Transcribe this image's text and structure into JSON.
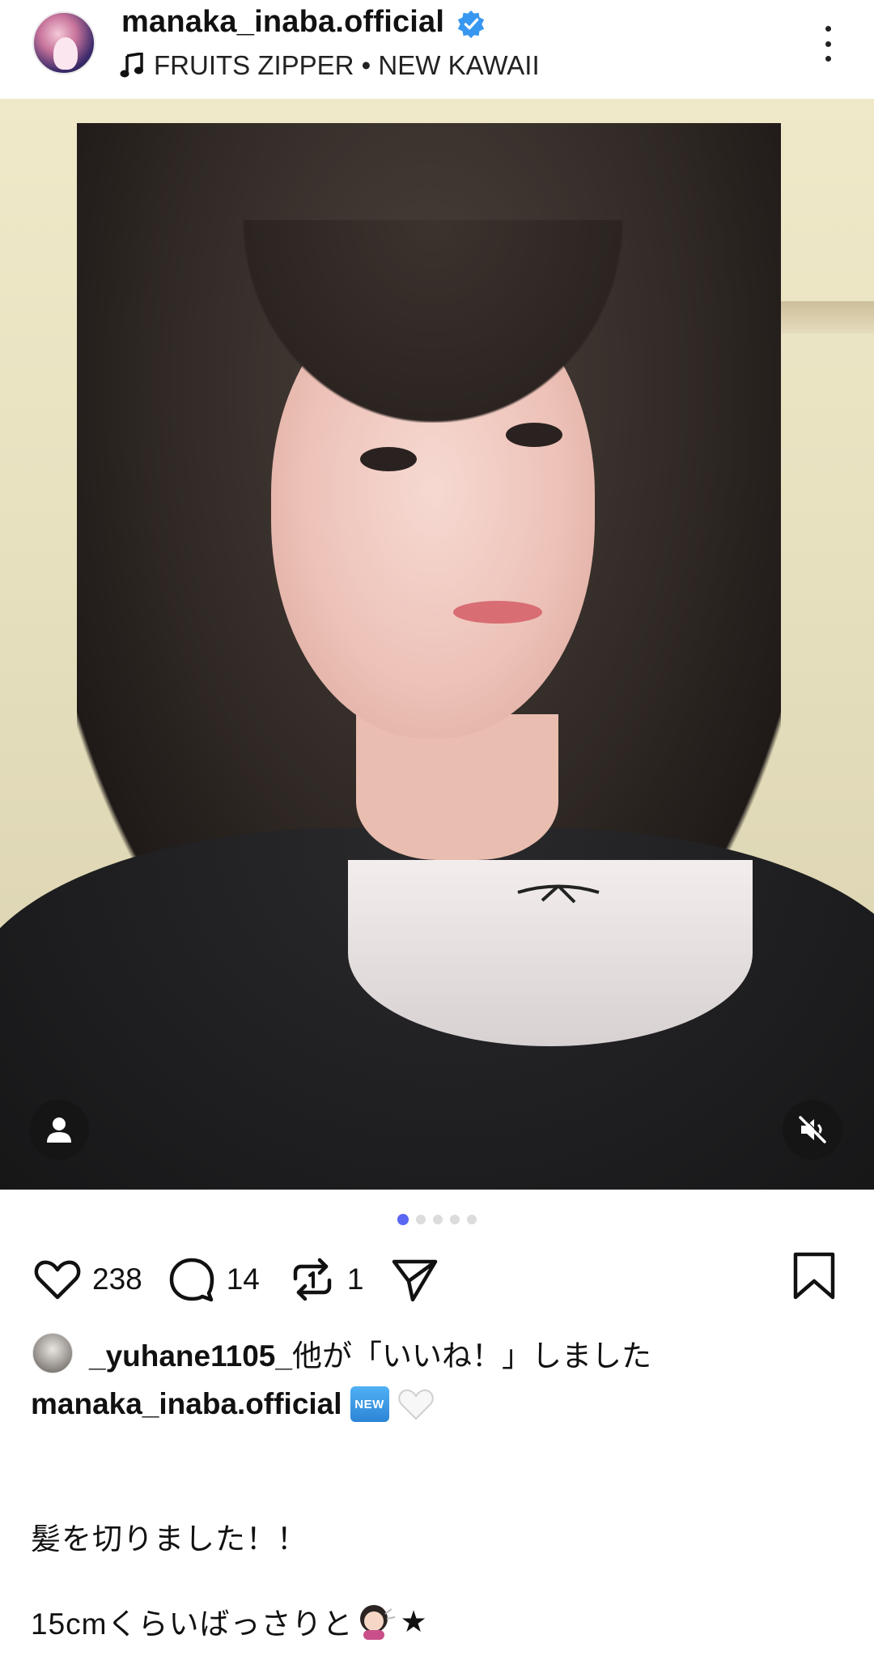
{
  "header": {
    "username": "manaka_inaba.official",
    "music": "FRUITS ZIPPER • NEW KAWAII",
    "icons": [
      "avatar",
      "verified-badge-icon",
      "music-note-icon",
      "more-options-icon"
    ]
  },
  "media": {
    "carousel": {
      "total": 5,
      "active_index": 0
    },
    "icons": [
      "profile-tag-icon",
      "mute-icon"
    ]
  },
  "actions": {
    "likes": "238",
    "comments": "14",
    "reposts": "1",
    "icons": [
      "heart-icon",
      "comment-icon",
      "repost-icon",
      "share-icon",
      "bookmark-icon"
    ]
  },
  "liked_by": {
    "name": "_yuhane1105_",
    "suffix": "他が「いいね！」しました"
  },
  "caption": {
    "author": "manaka_inaba.official",
    "new_badge": "NEW",
    "line1": "髪を切りました！！",
    "line2": "15cmくらいばっさりと",
    "line2_end": "★"
  },
  "colors": {
    "accent_dot": "#5a67f2",
    "verified": "#3897f0"
  }
}
